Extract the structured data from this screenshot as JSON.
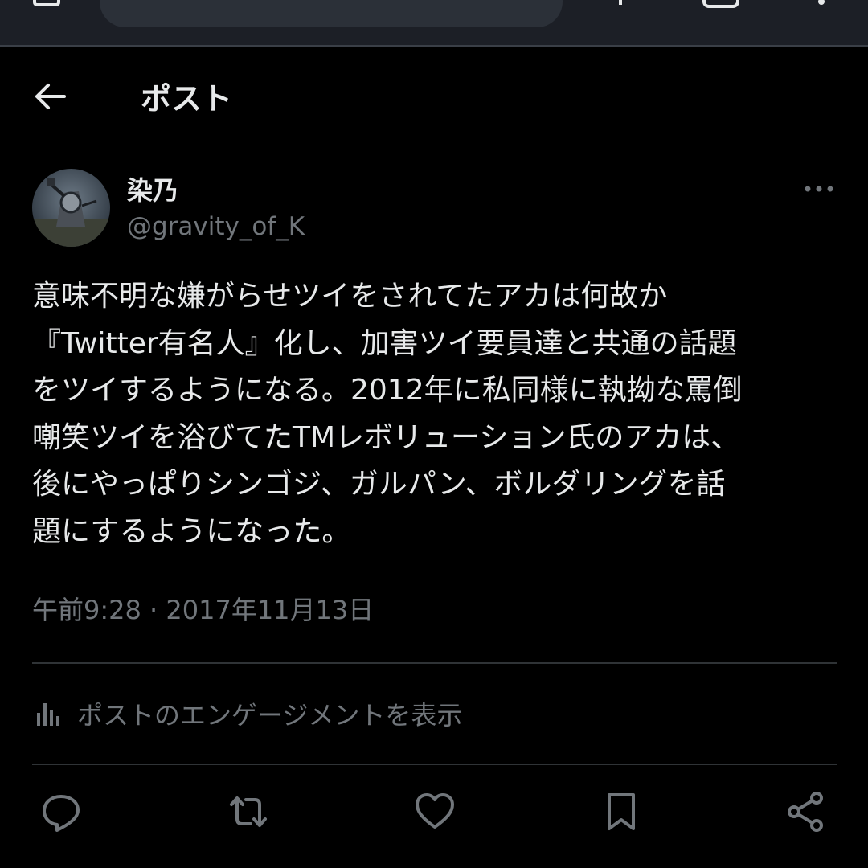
{
  "header": {
    "title": "ポスト"
  },
  "post": {
    "author_name": "染乃",
    "author_handle": "@gravity_of_K",
    "text_lines": [
      "意味不明な嫌がらせツイをされてたアカは何故か",
      "『Twitter有名人』化し、加害ツイ要員達と共通の話題",
      "をツイするようになる。2012年に私同様に執拗な罵倒",
      "嘲笑ツイを浴びてたTMレボリューション氏のアカは、",
      "後にやっぱりシンゴジ、ガルパン、ボルダリングを話",
      "題にするようになった。"
    ],
    "timestamp": "午前9:28 · 2017年11月13日"
  },
  "engagement": {
    "label": "ポストのエンゲージメントを表示",
    "icon": "bar-chart-icon"
  },
  "actions": {
    "icons": [
      "reply-icon",
      "repost-icon",
      "like-icon",
      "bookmark-icon",
      "share-icon"
    ]
  },
  "colors": {
    "background": "#000000",
    "text_primary": "#e7e9ea",
    "text_secondary": "#71767b",
    "divider": "#2f3336",
    "browser_bar": "#1c1f26"
  }
}
